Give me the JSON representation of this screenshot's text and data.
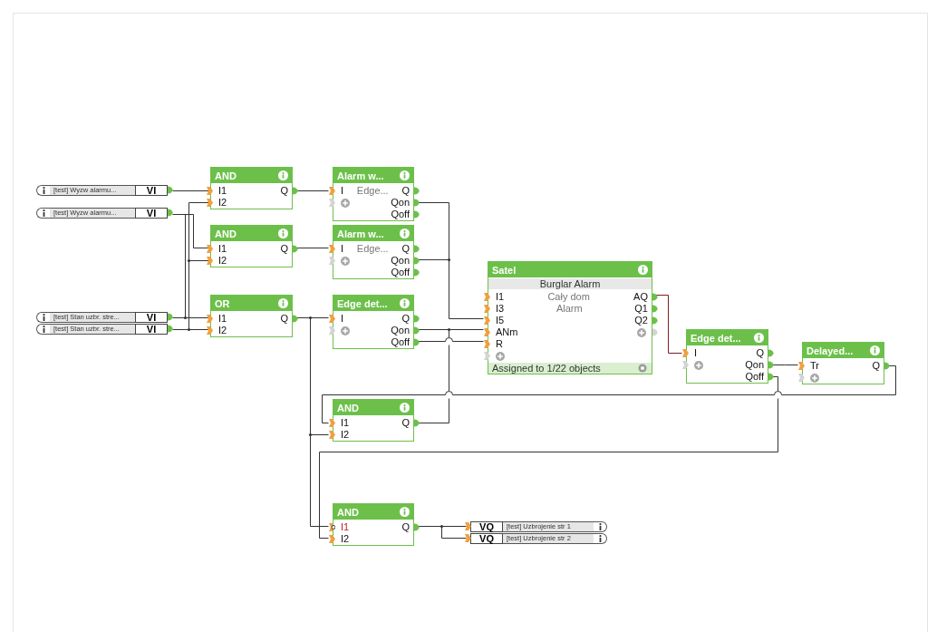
{
  "inputs": [
    {
      "label": "[test] Wyzw alarmu...",
      "tag": "VI"
    },
    {
      "label": "[test] Wyzw alarmu...",
      "tag": "VI"
    },
    {
      "label": "[test] Stan uzbr. stre...",
      "tag": "VI"
    },
    {
      "label": "[test] Stan uzbr. stre...",
      "tag": "VI"
    }
  ],
  "blocks": [
    {
      "title": "AND",
      "inputs": [
        {
          "kind": "port",
          "label": "I1",
          "inverted": false
        },
        {
          "kind": "port",
          "label": "I2",
          "inverted": false
        }
      ],
      "outputs": [
        {
          "kind": "port",
          "label": "Q"
        }
      ]
    },
    {
      "title": "AND",
      "inputs": [
        {
          "kind": "port",
          "label": "I1",
          "inverted": false
        },
        {
          "kind": "port",
          "label": "I2",
          "inverted": false
        }
      ],
      "outputs": [
        {
          "kind": "port",
          "label": "Q"
        }
      ]
    },
    {
      "title": "OR",
      "inputs": [
        {
          "kind": "port",
          "label": "I1",
          "inverted": false
        },
        {
          "kind": "port",
          "label": "I2",
          "inverted": false
        }
      ],
      "outputs": [
        {
          "kind": "port",
          "label": "Q"
        }
      ]
    },
    {
      "title": "Alarm w...",
      "inputs": [
        {
          "kind": "port",
          "label": "I",
          "inverted": false
        },
        {
          "kind": "add"
        }
      ],
      "notes": [
        "Edge..."
      ],
      "outputs": [
        {
          "kind": "port",
          "label": "Q"
        },
        {
          "kind": "port",
          "label": "Qon"
        },
        {
          "kind": "port",
          "label": "Qoff"
        }
      ]
    },
    {
      "title": "Alarm w...",
      "inputs": [
        {
          "kind": "port",
          "label": "I",
          "inverted": false
        },
        {
          "kind": "add"
        }
      ],
      "notes": [
        "Edge..."
      ],
      "outputs": [
        {
          "kind": "port",
          "label": "Q"
        },
        {
          "kind": "port",
          "label": "Qon"
        },
        {
          "kind": "port",
          "label": "Qoff"
        }
      ]
    },
    {
      "title": "Edge det...",
      "inputs": [
        {
          "kind": "port",
          "label": "I",
          "inverted": false
        },
        {
          "kind": "add"
        }
      ],
      "outputs": [
        {
          "kind": "port",
          "label": "Q"
        },
        {
          "kind": "port",
          "label": "Qon"
        },
        {
          "kind": "port",
          "label": "Qoff"
        }
      ]
    },
    {
      "title": "AND",
      "inputs": [
        {
          "kind": "port",
          "label": "I1",
          "inverted": false
        },
        {
          "kind": "port",
          "label": "I2",
          "inverted": false
        }
      ],
      "outputs": [
        {
          "kind": "port",
          "label": "Q"
        }
      ]
    },
    {
      "title": "AND",
      "inputs": [
        {
          "kind": "port",
          "label": "I1",
          "inverted": true
        },
        {
          "kind": "port",
          "label": "I2",
          "inverted": false
        }
      ],
      "outputs": [
        {
          "kind": "port",
          "label": "Q"
        }
      ]
    },
    {
      "title": "Satel",
      "subtitle": "Burglar Alarm",
      "inputs": [
        {
          "kind": "port",
          "label": "I1",
          "inverted": false
        },
        {
          "kind": "port",
          "label": "I3",
          "inverted": false
        },
        {
          "kind": "port",
          "label": "I5",
          "inverted": false
        },
        {
          "kind": "port",
          "label": "ANm",
          "inverted": false
        },
        {
          "kind": "port",
          "label": "R",
          "inverted": false
        },
        {
          "kind": "add"
        }
      ],
      "notes": [
        "Cały dom",
        "Alarm"
      ],
      "outputs": [
        {
          "kind": "port",
          "label": "AQ"
        },
        {
          "kind": "port",
          "label": "Q1"
        },
        {
          "kind": "port",
          "label": "Q2"
        },
        {
          "kind": "add"
        }
      ],
      "footer": "Assigned to 1/22 objects"
    },
    {
      "title": "Edge det...",
      "inputs": [
        {
          "kind": "port",
          "label": "I",
          "inverted": false
        },
        {
          "kind": "add"
        }
      ],
      "outputs": [
        {
          "kind": "port",
          "label": "Q"
        },
        {
          "kind": "port",
          "label": "Qon"
        },
        {
          "kind": "port",
          "label": "Qoff"
        }
      ]
    },
    {
      "title": "Delayed...",
      "inputs": [
        {
          "kind": "port",
          "label": "Tr",
          "inverted": false
        },
        {
          "kind": "add"
        }
      ],
      "outputs": [
        {
          "kind": "port",
          "label": "Q"
        }
      ]
    }
  ],
  "outputs": [
    {
      "label": "[test] Uzbrojenie str 1",
      "tag": "VQ"
    },
    {
      "label": "[test] Uzbrojenie str 2",
      "tag": "VQ"
    }
  ]
}
